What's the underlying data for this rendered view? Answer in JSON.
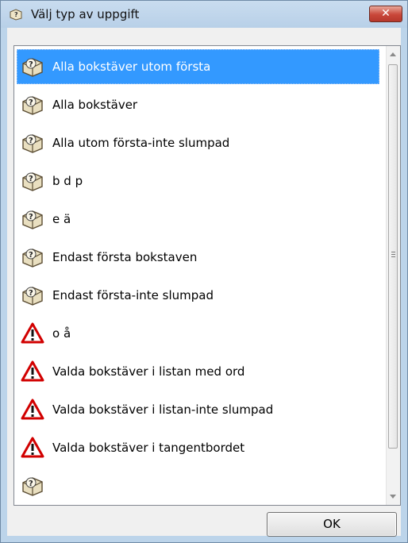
{
  "window": {
    "title": "Välj typ av uppgift",
    "close_label": "✕"
  },
  "list": {
    "items": [
      {
        "label": "Alla bokstäver utom första",
        "icon": "question-book-icon",
        "selected": true
      },
      {
        "label": "Alla bokstäver",
        "icon": "question-book-icon"
      },
      {
        "label": "Alla utom första-inte slumpad",
        "icon": "question-book-icon"
      },
      {
        "label": "b d p",
        "icon": "question-book-icon"
      },
      {
        "label": "e ä",
        "icon": "question-book-icon"
      },
      {
        "label": "Endast första bokstaven",
        "icon": "question-book-icon"
      },
      {
        "label": "Endast första-inte slumpad",
        "icon": "question-book-icon"
      },
      {
        "label": "o å",
        "icon": "warning-icon"
      },
      {
        "label": "Valda bokstäver i listan med ord",
        "icon": "warning-icon"
      },
      {
        "label": "Valda bokstäver i listan-inte slumpad",
        "icon": "warning-icon"
      },
      {
        "label": "Valda bokstäver i tangentbordet",
        "icon": "warning-icon"
      }
    ]
  },
  "buttons": {
    "ok_label": "OK"
  },
  "colors": {
    "selection": "#3399ff",
    "warning": "#cc0000"
  }
}
